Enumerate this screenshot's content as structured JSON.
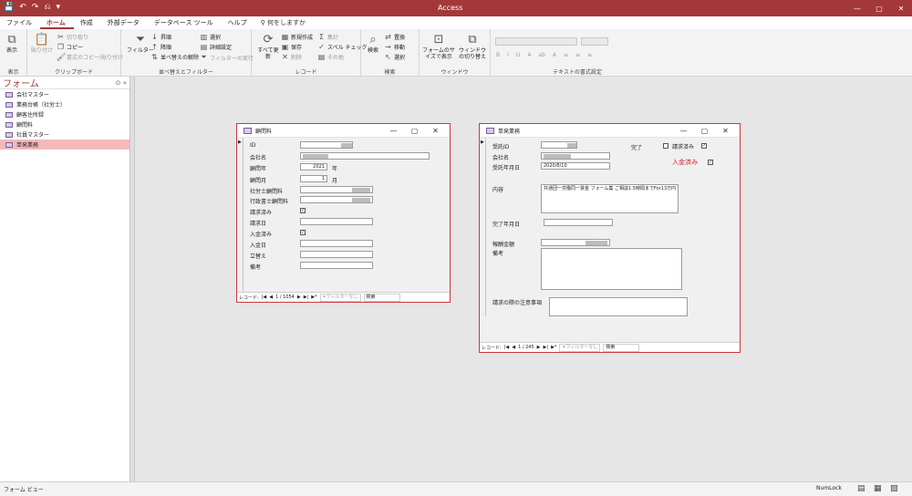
{
  "titlebar": {
    "title": "Access",
    "qat": [
      "💾",
      "↶",
      "↷",
      "⎌",
      "▾"
    ],
    "win": [
      "—",
      "▢",
      "✕"
    ]
  },
  "tabs": {
    "items": [
      "ファイル",
      "ホーム",
      "作成",
      "外部データ",
      "データベース ツール",
      "ヘルプ"
    ],
    "active_index": 1,
    "tell_me": "何をしますか"
  },
  "ribbon": {
    "groups": {
      "view": "表示",
      "clipboard": "クリップボード",
      "sort_filter": "並べ替えとフィルター",
      "records": "レコード",
      "find": "検索",
      "window": "ウィンドウ",
      "text_format": "テキストの書式設定"
    },
    "view_btn": "表示",
    "paste_btn": "貼り付け",
    "cut": "切り取り",
    "copy": "コピー",
    "format_painter": "書式のコピー/貼り付け",
    "filter_btn": "フィルター",
    "ascending": "昇順",
    "descending": "降順",
    "remove_sort": "並べ替えの解除",
    "selection": "選択",
    "advanced": "詳細設定",
    "toggle_filter": "フィルターの実行",
    "refresh_btn": "すべて更新",
    "new": "新規作成",
    "save": "保存",
    "delete": "削除",
    "totals": "集計",
    "spelling": "スペル チェック",
    "more": "その他",
    "find_btn": "検索",
    "replace": "置換",
    "goto": "移動",
    "select": "選択",
    "fit_form_btn": "フォームのサイズで表示",
    "switch_windows_btn": "ウィンドウの切り替え",
    "text_format_btns": [
      "B",
      "I",
      "U",
      "A",
      "ab",
      "A"
    ]
  },
  "nav": {
    "title": "フォーム",
    "items": [
      "会社マスター",
      "業務台帳（社労士）",
      "顧客住所録",
      "顧問料",
      "社員マスター",
      "単発業務"
    ],
    "selected_index": 5
  },
  "form1": {
    "title": "顧問料",
    "labels": [
      "ID",
      "会社名",
      "顧問年",
      "顧問月",
      "社労士顧問料",
      "行政書士顧問料",
      "請求済み",
      "請求日",
      "入金済み",
      "入金日",
      "立替え",
      "備考"
    ],
    "year_value": "2021",
    "year_unit": "年",
    "month_value": "1",
    "month_unit": "月",
    "checks": {
      "invoiced": "✓",
      "paid": "✓"
    },
    "recnav": {
      "label": "レコード:",
      "position": "1 / 1054",
      "filter": "フィルターなし",
      "search": "検索"
    }
  },
  "form2": {
    "title": "単発業務",
    "labels": {
      "id": "受託ID",
      "company": "会社名",
      "date": "受託年月日",
      "content": "内容",
      "done_date": "完了年月日",
      "fee": "報酬金額",
      "memo": "備考",
      "note": "請求の際の注意事項"
    },
    "date_value": "2020/8/10",
    "content_value": "共通団一労働同一賃金 フォーム集 ご相談1.5時間までFor13万円",
    "flags": {
      "done": "完了",
      "invoiced": "請求済み",
      "paid": "入金済み",
      "paid_color": "#d0202a"
    },
    "checks": {
      "invoiced": "✓",
      "paid": "✓"
    },
    "recnav": {
      "label": "レコード:",
      "position": "1 / 245",
      "filter": "フィルターなし",
      "search": "検索"
    }
  },
  "statusbar": {
    "left": "フォーム ビュー",
    "numlock": "NumLock",
    "views": [
      "▤",
      "▦",
      "▧"
    ]
  }
}
